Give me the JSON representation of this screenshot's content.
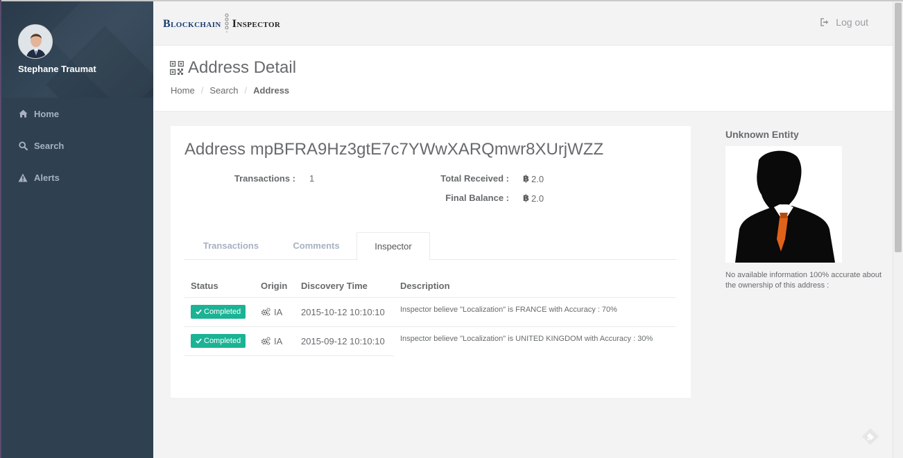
{
  "sidebar": {
    "user_name": "Stephane Traumat",
    "nav": [
      {
        "label": "Home",
        "icon": "home-icon"
      },
      {
        "label": "Search",
        "icon": "search-icon"
      },
      {
        "label": "Alerts",
        "icon": "warning-icon"
      }
    ]
  },
  "header": {
    "logo_left": "Blockchain",
    "logo_right": "Inspector",
    "logout_label": "Log out"
  },
  "page": {
    "title": "Address Detail",
    "breadcrumb": [
      "Home",
      "Search",
      "Address"
    ]
  },
  "address": {
    "title": "Address mpBFRA9Hz3gtE7c7YWwXARQmwr8XUrjWZZ",
    "transactions_label": "Transactions :",
    "transactions_value": "1",
    "total_received_label": "Total Received :",
    "total_received_value": "2.0",
    "final_balance_label": "Final Balance :",
    "final_balance_value": "2.0",
    "currency_symbol": "฿"
  },
  "tabs": {
    "transactions": "Transactions",
    "comments": "Comments",
    "inspector": "Inspector",
    "active": "Inspector"
  },
  "table": {
    "headers": {
      "status": "Status",
      "origin": "Origin",
      "discovery_time": "Discovery Time",
      "description": "Description"
    },
    "rows": [
      {
        "status": "Completed",
        "origin": "IA",
        "discovery_time": "2015-10-12 10:10:10",
        "description": "Inspector believe \"Localization\" is FRANCE with Accuracy : 70%"
      },
      {
        "status": "Completed",
        "origin": "IA",
        "discovery_time": "2015-09-12 10:10:10",
        "description": "Inspector believe \"Localization\" is UNITED KINGDOM with Accuracy : 30%"
      }
    ]
  },
  "entity": {
    "title": "Unknown Entity",
    "note": "No available information 100% accurate about the ownership of this address :"
  },
  "colors": {
    "sidebar_bg": "#2f4050",
    "accent_green": "#1ab394",
    "tie_orange": "#e0621a"
  }
}
